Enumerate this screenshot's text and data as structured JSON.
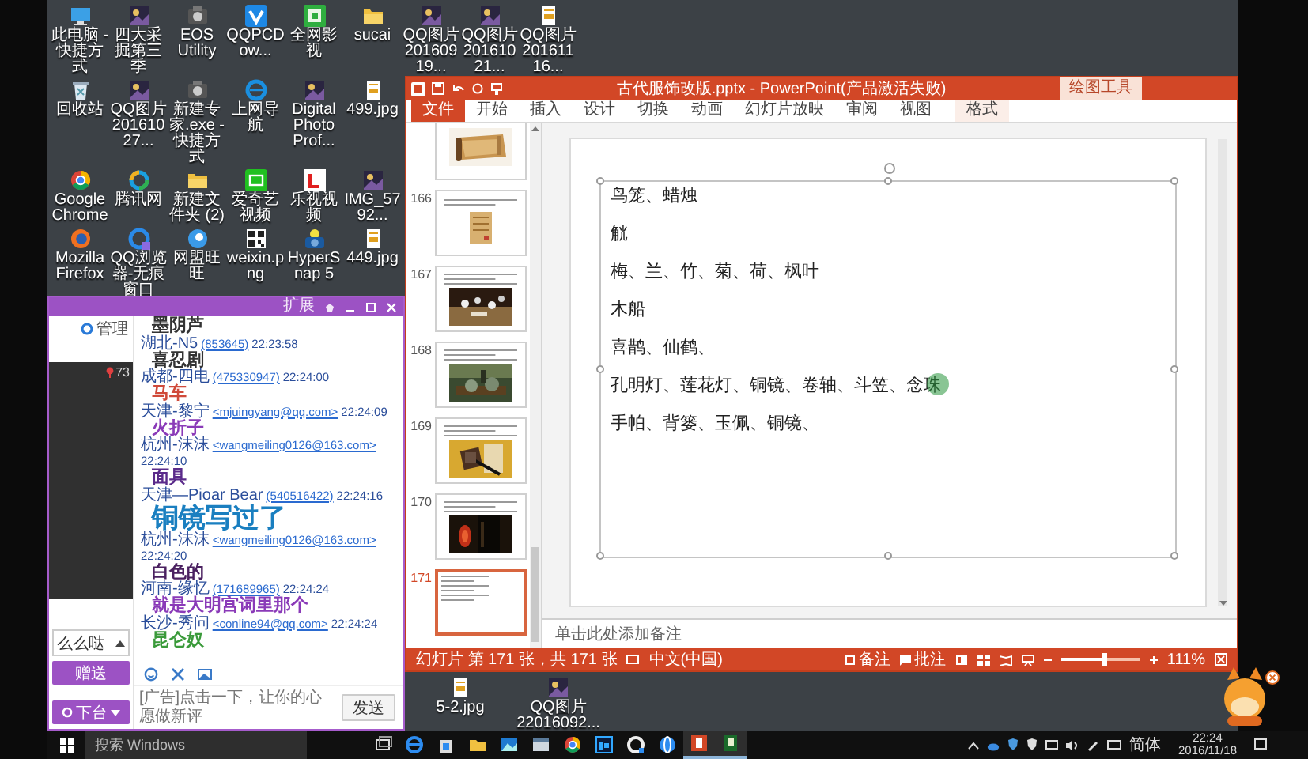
{
  "desktop": {
    "icon_rows": [
      [
        "此电脑 - 快捷方式",
        "四大采掘第三季",
        "EOS Utility",
        "QQPCDow...",
        "全网影视",
        "sucai",
        "QQ图片 20160919...",
        "QQ图片 20161021...",
        "QQ图片 20161116..."
      ],
      [
        "回收站",
        "QQ图片 20161027...",
        "新建专家.exe - 快捷方式",
        "上网导航",
        "Digital Photo Prof...",
        "499.jpg"
      ],
      [
        "Google Chrome",
        "腾讯网",
        "新建文件夹 (2)",
        "爱奇艺视频",
        "乐视视频",
        "IMG_5792..."
      ],
      [
        "Mozilla Firefox",
        "QQ浏览器-无痕窗口",
        "网盟旺旺",
        "weixin.png",
        "HyperSnap 5",
        "449.jpg"
      ]
    ],
    "bottom_icons": [
      "5-2.jpg",
      "QQ图片 22016092..."
    ]
  },
  "qq_window": {
    "title_link": "扩展",
    "manage": "管理",
    "viewer_count": "73",
    "gift_select": "么么哒",
    "gift_button": "赠送",
    "leave_button": "下台",
    "chat": [
      {
        "kind": "message",
        "text": "墨阴芦",
        "color": "#333333"
      },
      {
        "kind": "sender",
        "name": "湖北-N5",
        "contact": "(853645)",
        "time": "22:23:58"
      },
      {
        "kind": "message",
        "text": "喜忍剧",
        "color": "#333333"
      },
      {
        "kind": "sender",
        "name": "成都-四电",
        "contact": "(475330947)",
        "time": "22:24:00"
      },
      {
        "kind": "message",
        "text": "马车",
        "color": "#d04a3a"
      },
      {
        "kind": "sender",
        "name": "天津-黎宁",
        "contact": "<mjuingyang@qq.com>",
        "time": "22:24:09"
      },
      {
        "kind": "message",
        "text": "火折子",
        "color": "#8a3ab8"
      },
      {
        "kind": "sender",
        "name": "杭州-沫沫",
        "contact": "<wangmeiling0126@163.com>",
        "time": "22:24:10"
      },
      {
        "kind": "message",
        "text": "面具",
        "color": "#5a2a8a"
      },
      {
        "kind": "sender",
        "name": "天津—Pioar Bear",
        "contact": "(540516422)",
        "time": "22:24:16"
      },
      {
        "kind": "big_message",
        "text": "铜镜写过了",
        "color": "#1a7fc0"
      },
      {
        "kind": "sender",
        "name": "杭州-沫沫",
        "contact": "<wangmeiling0126@163.com>",
        "time": "22:24:20"
      },
      {
        "kind": "message",
        "text": "白色的",
        "color": "#4a2060"
      },
      {
        "kind": "sender",
        "name": "河南-缘忆",
        "contact": "(171689965)",
        "time": "22:24:24"
      },
      {
        "kind": "message",
        "text": "就是大明宫词里那个",
        "color": "#8a3ab8"
      },
      {
        "kind": "sender",
        "name": "长沙-秀问",
        "contact": "<conline94@qq.com>",
        "time": "22:24:24"
      },
      {
        "kind": "message",
        "text": "昆仑奴",
        "color": "#3a9a3a"
      }
    ],
    "input_placeholder": "[广告]点击一下，让你的心愿做新评",
    "send_button": "发送"
  },
  "ppt_window": {
    "title": "古代服饰改版.pptx - PowerPoint(产品激活失败)",
    "context_tab": "绘图工具",
    "tabs": [
      {
        "label": "文件",
        "kind": "file"
      },
      {
        "label": "开始",
        "kind": "normal"
      },
      {
        "label": "插入",
        "kind": "normal"
      },
      {
        "label": "设计",
        "kind": "normal"
      },
      {
        "label": "切换",
        "kind": "normal"
      },
      {
        "label": "动画",
        "kind": "normal"
      },
      {
        "label": "幻灯片放映",
        "kind": "normal"
      },
      {
        "label": "审阅",
        "kind": "normal"
      },
      {
        "label": "视图",
        "kind": "normal"
      },
      {
        "label": "格式",
        "kind": "context"
      }
    ],
    "thumbnails": [
      {
        "kind": "picture",
        "selected": false
      },
      {
        "number": "166",
        "kind": "text_picture",
        "selected": false
      },
      {
        "number": "167",
        "kind": "text_picture",
        "selected": false
      },
      {
        "number": "168",
        "kind": "text_picture",
        "selected": false
      },
      {
        "number": "169",
        "kind": "text_picture",
        "selected": false
      },
      {
        "number": "170",
        "kind": "text_picture",
        "selected": false
      },
      {
        "number": "171",
        "kind": "text_only",
        "selected": true
      }
    ],
    "slide_lines": [
      "鸟笼、蜡烛",
      "觥",
      "梅、兰、竹、菊、荷、枫叶",
      "木船",
      "喜鹊、仙鹤、",
      "孔明灯、莲花灯、铜镜、卷轴、斗笠、念珠",
      "手帕、背篓、玉佩、铜镜、"
    ],
    "notes_placeholder": "单击此处添加备注",
    "status": {
      "slide_info": "幻灯片 第 171 张，共 171 张",
      "language": "中文(中国)",
      "notes": "备注",
      "comments": "批注",
      "zoom": "111%",
      "level": 0.55
    }
  },
  "taskbar": {
    "search_placeholder": "搜索 Windows",
    "apps": [
      {
        "kind": "taskview",
        "running": false
      },
      {
        "kind": "edge",
        "running": false
      },
      {
        "kind": "store",
        "running": false
      },
      {
        "kind": "explorer",
        "running": false
      },
      {
        "kind": "photos",
        "running": false
      },
      {
        "kind": "window",
        "running": false
      },
      {
        "kind": "chrome",
        "running": false
      },
      {
        "kind": "photoshop",
        "running": false
      },
      {
        "kind": "qqbrowser",
        "running": false
      },
      {
        "kind": "globe",
        "running": false
      },
      {
        "kind": "powerpoint",
        "running": true
      },
      {
        "kind": "recorder",
        "running": true
      }
    ],
    "language": "简体",
    "time": "22:24",
    "date": "2016/11/18"
  }
}
